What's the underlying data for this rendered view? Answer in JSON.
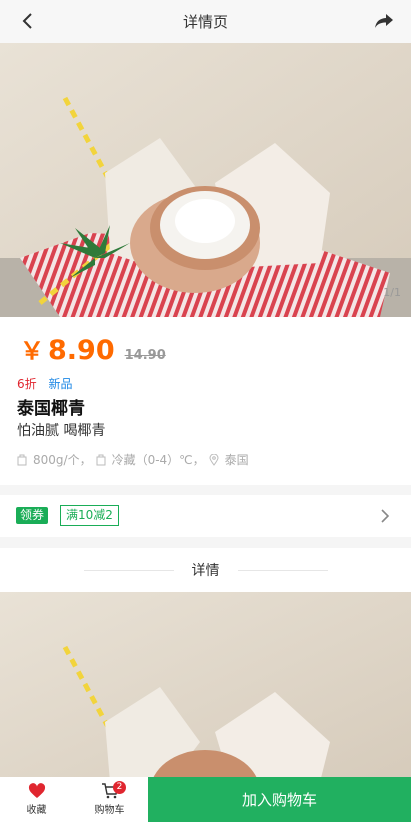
{
  "header": {
    "title": "详情页",
    "back_icon": "chevron-left-icon",
    "share_icon": "share-arrow-icon"
  },
  "gallery": {
    "pager": "1/1"
  },
  "product": {
    "currency": "￥",
    "price": "8.90",
    "original_price": "14.90",
    "tag_discount": "6折",
    "tag_new": "新品",
    "name": "泰国椰青",
    "subtitle": "怕油腻 喝椰青",
    "spec_weight": "800g/个，",
    "spec_storage": "冷藏（0-4）℃，",
    "spec_origin": "泰国"
  },
  "coupon": {
    "label": "领券",
    "chip": "满10减2"
  },
  "detail": {
    "heading": "详情"
  },
  "bottom_bar": {
    "favorite_label": "收藏",
    "cart_label": "购物车",
    "cart_count": "2",
    "add_to_cart": "加入购物车"
  },
  "colors": {
    "price": "#ff6a00",
    "accent_green": "#21b060",
    "badge_red": "#e0262f",
    "tag_blue": "#1e88e5"
  }
}
